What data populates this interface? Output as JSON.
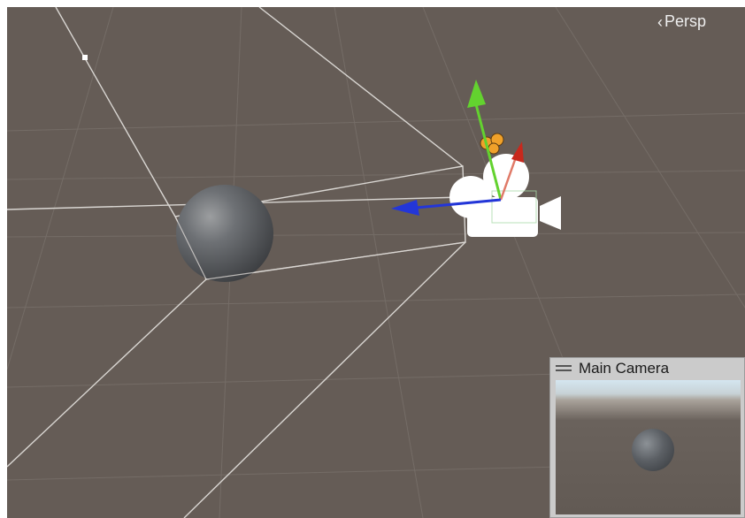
{
  "scene_view": {
    "projection_label": "Persp",
    "projection_icon": "chevron-left-icon",
    "background_color": "#655c56"
  },
  "gizmo": {
    "axis_colors": {
      "x": "#c8281c",
      "y": "#63d22f",
      "z": "#2336d8"
    },
    "light_icon_color": "#f0a12a"
  },
  "camera_preview": {
    "title": "Main Camera",
    "drag_icon": "drag-handle-icon"
  }
}
